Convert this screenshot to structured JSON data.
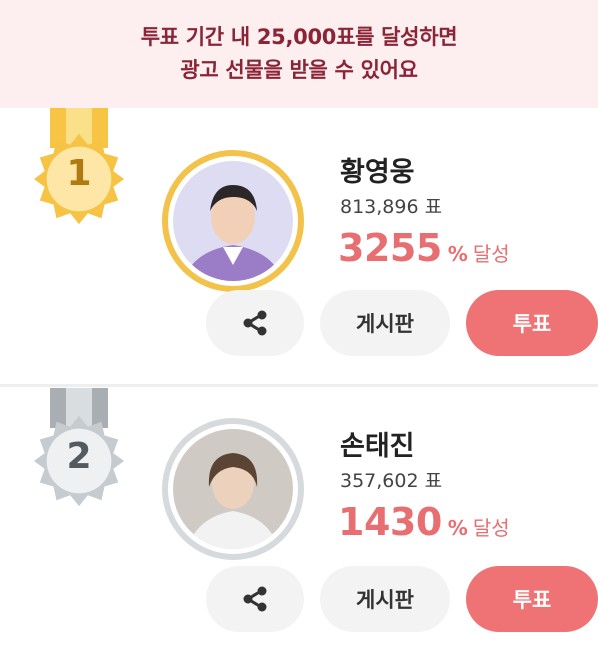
{
  "banner": {
    "line1": "투표 기간 내 25,000표를 달성하면",
    "line2": "광고 선물을 받을 수 있어요"
  },
  "candidates": [
    {
      "rank": "1",
      "name": "황영웅",
      "votes": "813,896",
      "votes_unit": "표",
      "percent": "3255",
      "percent_symbol": "%",
      "percent_label": "달성",
      "medal": "gold-medal-icon",
      "share_icon": "share-icon",
      "board_label": "게시판",
      "vote_label": "투표"
    },
    {
      "rank": "2",
      "name": "손태진",
      "votes": "357,602",
      "votes_unit": "표",
      "percent": "1430",
      "percent_symbol": "%",
      "percent_label": "달성",
      "medal": "silver-medal-icon",
      "share_icon": "share-icon",
      "board_label": "게시판",
      "vote_label": "투표"
    }
  ],
  "colors": {
    "banner_bg": "#fdeef0",
    "banner_text": "#8a2436",
    "accent": "#e76f72",
    "vote_button": "#ef7375",
    "gold": "#f5c242",
    "silver": "#c9ced3"
  }
}
